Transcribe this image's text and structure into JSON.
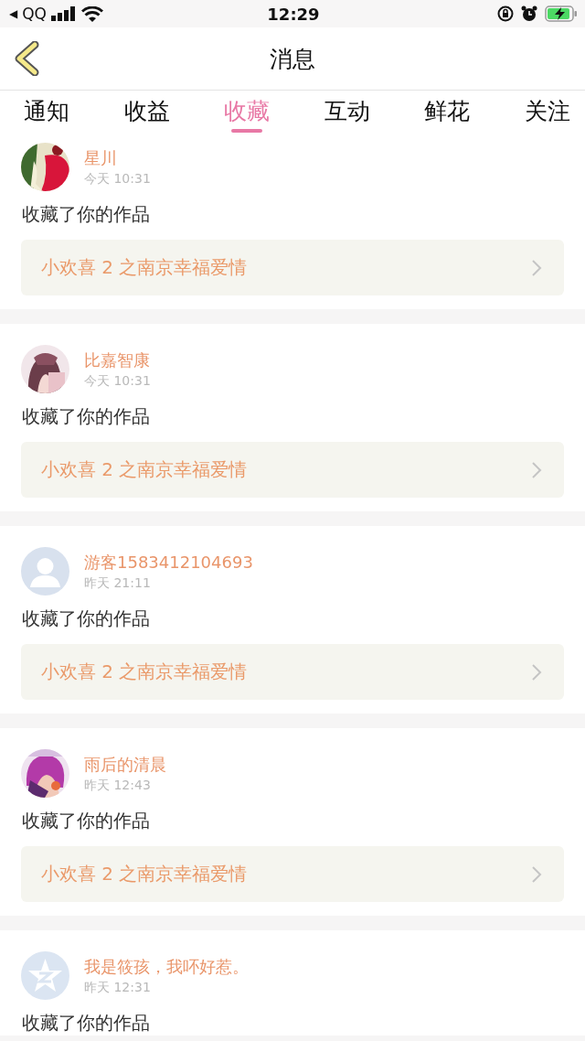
{
  "status_bar": {
    "back_arrow": "◀",
    "back_app": "QQ",
    "time": "12:29"
  },
  "nav": {
    "title": "消息"
  },
  "tabs": [
    {
      "label": "通知",
      "selected": false
    },
    {
      "label": "收益",
      "selected": false
    },
    {
      "label": "收藏",
      "selected": true
    },
    {
      "label": "互动",
      "selected": false
    },
    {
      "label": "鲜花",
      "selected": false
    },
    {
      "label": "关注",
      "selected": false
    }
  ],
  "messages": [
    {
      "kind": "picture",
      "name": "星川",
      "time": "今天 10:31",
      "action": "收藏了你的作品",
      "work": "小欢喜 2 之南京幸福爱情"
    },
    {
      "kind": "picture",
      "name": "比嘉智康",
      "time": "今天 10:31",
      "action": "收藏了你的作品",
      "work": "小欢喜 2 之南京幸福爱情"
    },
    {
      "kind": "default",
      "name": "游客1583412104693",
      "time": "昨天 21:11",
      "action": "收藏了你的作品",
      "work": "小欢喜 2 之南京幸福爱情"
    },
    {
      "kind": "picture",
      "name": "雨后的清晨",
      "time": "昨天 12:43",
      "action": "收藏了你的作品",
      "work": "小欢喜 2 之南京幸福爱情"
    },
    {
      "kind": "star",
      "name": "我是筱孩，我吥好惹。",
      "time": "昨天 12:31",
      "action": "收藏了你的作品"
    }
  ]
}
